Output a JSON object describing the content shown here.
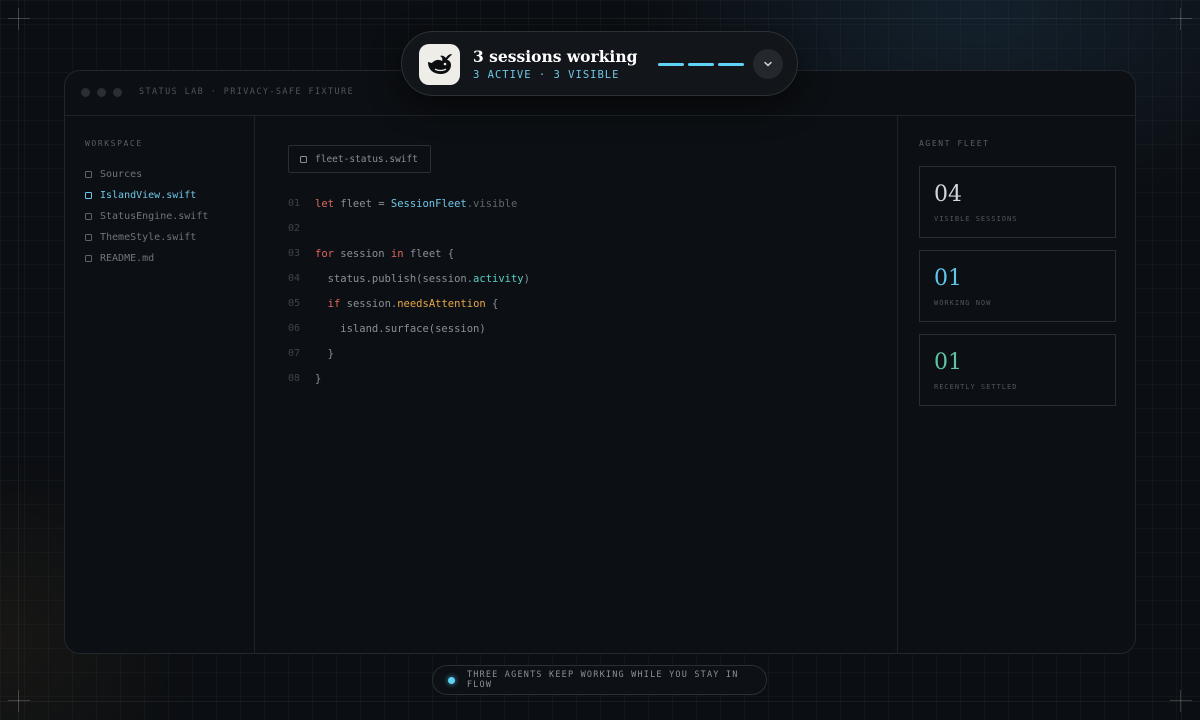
{
  "window": {
    "title": "STATUS LAB · PRIVACY-SAFE FIXTURE"
  },
  "island": {
    "title": "3 sessions working",
    "subtitle": "3 ACTIVE · 3 VISIBLE",
    "app_icon": "whale-icon",
    "expand_icon": "chevron-down-icon",
    "accent": "#5fd3f5"
  },
  "sidebar": {
    "label": "WORKSPACE",
    "items": [
      {
        "label": "Sources",
        "active": false
      },
      {
        "label": "IslandView.swift",
        "active": true
      },
      {
        "label": "StatusEngine.swift",
        "active": false
      },
      {
        "label": "ThemeStyle.swift",
        "active": false
      },
      {
        "label": "README.md",
        "active": false
      }
    ]
  },
  "editor": {
    "tab": "fleet-status.swift",
    "lines": [
      {
        "num": "01",
        "tokens": [
          {
            "t": "let",
            "c": "kw"
          },
          {
            "t": " fleet = "
          },
          {
            "t": "SessionFleet",
            "c": "ty"
          },
          {
            "t": ".visible",
            "c": "mu"
          }
        ]
      },
      {
        "num": "02",
        "tokens": []
      },
      {
        "num": "03",
        "tokens": [
          {
            "t": "for",
            "c": "kw"
          },
          {
            "t": " session "
          },
          {
            "t": "in",
            "c": "kw"
          },
          {
            "t": " fleet {"
          }
        ]
      },
      {
        "num": "04",
        "tokens": [
          {
            "t": "  status.publish(session."
          },
          {
            "t": "activity",
            "c": "pr"
          },
          {
            "t": ")"
          }
        ]
      },
      {
        "num": "05",
        "tokens": [
          {
            "t": "  "
          },
          {
            "t": "if",
            "c": "kw"
          },
          {
            "t": " session."
          },
          {
            "t": "needsAttention",
            "c": "at"
          },
          {
            "t": " {"
          }
        ]
      },
      {
        "num": "06",
        "tokens": [
          {
            "t": "    island.surface(session)"
          }
        ]
      },
      {
        "num": "07",
        "tokens": [
          {
            "t": "  }"
          }
        ]
      },
      {
        "num": "08",
        "tokens": [
          {
            "t": "}"
          }
        ]
      }
    ]
  },
  "fleet": {
    "label": "AGENT FLEET",
    "cards": [
      {
        "value": "04",
        "label": "VISIBLE SESSIONS",
        "color": "#d2d5da"
      },
      {
        "value": "01",
        "label": "WORKING NOW",
        "color": "#5fc6e8"
      },
      {
        "value": "01",
        "label": "RECENTLY SETTLED",
        "color": "#5fc3a4"
      }
    ]
  },
  "footer": {
    "text": "THREE AGENTS KEEP WORKING WHILE YOU STAY IN FLOW"
  }
}
